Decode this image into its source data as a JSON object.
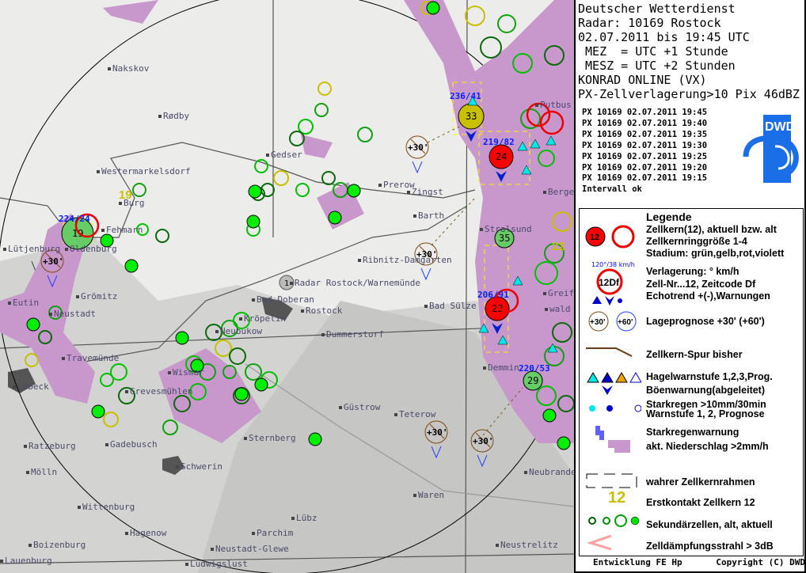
{
  "header": {
    "line1": "Deutscher Wetterdienst",
    "line2": "Radar: 10169 Rostock",
    "line3": "02.07.2011 bis 19:45 UTC",
    "line4": " MEZ  = UTC +1 Stunde",
    "line5": " MESZ = UTC +2 Stunden",
    "line6": "KONRAD ONLINE (VX)",
    "line7": "PX-Zellverlagerung>10 Pix 46dBZ"
  },
  "products": [
    "PX 10169 02.07.2011 19:45",
    "PX 10169 02.07.2011 19:40",
    "PX 10169 02.07.2011 19:35",
    "PX 10169 02.07.2011 19:30",
    "PX 10169 02.07.2011 19:25",
    "PX 10169 02.07.2011 19:20",
    "PX 10169 02.07.2011 19:15"
  ],
  "interval_status": "Intervall ok",
  "logo_text": "DWD",
  "legend": {
    "title": "Legende",
    "core": [
      "Zellkern(12), aktuell bzw. alt",
      "Zellkernringgröße 1-4",
      "Stadium: grün,gelb,rot,violett"
    ],
    "core_icon_label": "12",
    "motion": [
      "Verlagerung: ° km/h",
      "Zell-Nr...12, Zeitcode Df",
      "Echotrend +(-),Warnungen"
    ],
    "motion_icon_vector": "120°/38 km/h",
    "motion_icon_label": "12Df",
    "forecast": "Lageprognose +30' (+60')",
    "forecast_30": "+30'",
    "forecast_60": "+60'",
    "track": "Zellkern-Spur bisher",
    "hail": "Hagelwarnstufe 1,2,3,Prog.",
    "gust": "Böenwarnung(abgeleitet)",
    "rain": [
      "Starkregen >10mm/30min",
      "Warnstufe 1, 2, Prognose"
    ],
    "rainwarn": [
      "Starkregenwarnung",
      "akt. Niederschlag >2mm/h"
    ],
    "frame": "wahrer Zellkernrahmen",
    "first_contact": "Erstkontakt Zellkern 12",
    "first_contact_icon": "12",
    "secondary": "Sekundärzellen, alt, aktuell",
    "attenuation": "Zelldämpfungsstrahl > 3dB"
  },
  "footer": {
    "left": "Entwicklung FE Hp",
    "right": "Copyright (C) DWD"
  },
  "map": {
    "places": [
      "Nakskov",
      "Rødby",
      "Westermarkelsdorf",
      "Burg",
      "Fehmarn",
      "Lütjenburg",
      "Oldenburg",
      "Grömitz",
      "Eutin",
      "Neustadt",
      "Travemünde",
      "Lübeck",
      "Grevesmühlen",
      "Wismar",
      "Neubukow",
      "Kröpelin",
      "Bad Doberan",
      "Rostock",
      "Radar Rostock/Warnemünde",
      "Dummerstorf",
      "Gedser",
      "Prerow",
      "Zingst",
      "Barth",
      "Ribnitz-Damgarten",
      "Bad Sülze",
      "Stralsund",
      "Demmin",
      "Teterow",
      "Güstrow",
      "Sternberg",
      "Ratzeburg",
      "Gadebusch",
      "Schwerin",
      "Mölln",
      "Wittenburg",
      "Hagenow",
      "Boizenburg",
      "Lauenburg",
      "Ludwigslust",
      "Neustadt-Glewe",
      "Parchim",
      "Lübz",
      "Waren",
      "Neustrelitz",
      "Neubrandenburg",
      "Greifs-",
      "wald",
      "Putbus",
      "Bergen"
    ],
    "cells": [
      {
        "id": "33",
        "vector": "236/41",
        "stage": "yellow",
        "color": "#c8c000"
      },
      {
        "id": "24",
        "vector": "219/82",
        "stage": "red",
        "color": "#ff0000"
      },
      {
        "id": "22",
        "vector": "206/91",
        "stage": "red",
        "color": "#ff0000"
      },
      {
        "id": "35",
        "vector": "",
        "stage": "green",
        "color": "#66cc66"
      },
      {
        "id": "29",
        "vector": "220/53",
        "stage": "green",
        "color": "#66cc66"
      },
      {
        "id": "19",
        "vector": "224/24",
        "stage": "green",
        "color": "#66cc66"
      }
    ],
    "radar_label": "1",
    "forecast_label": "+30'",
    "first_contacts": [
      "19",
      "22"
    ]
  }
}
